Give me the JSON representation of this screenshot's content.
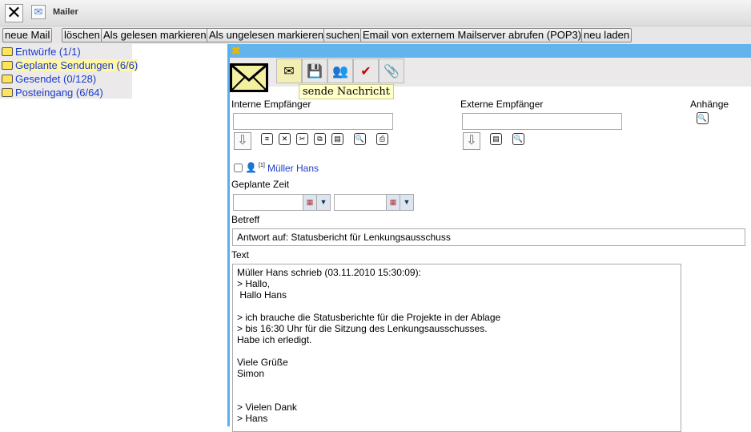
{
  "window": {
    "title": "Mailer"
  },
  "menu": [
    "neue Mail",
    "löschen",
    "Als gelesen markieren",
    "Als ungelesen markieren",
    "suchen",
    "Email von externem Mailserver abrufen (POP3)",
    "neu laden"
  ],
  "folders": [
    {
      "label": "Entwürfe (1/1)"
    },
    {
      "label": "Geplante Sendungen (6/6)",
      "selected": true
    },
    {
      "label": "Gesendet (0/128)"
    },
    {
      "label": "Posteingang (6/64)"
    }
  ],
  "tooltip": "sende Nachricht",
  "form": {
    "internal_label": "Interne Empfänger",
    "external_label": "Externe Empfänger",
    "attachments_label": "Anhänge",
    "recipient": "Müller Hans",
    "recipient_badge": "[1]",
    "planned_label": "Geplante Zeit",
    "subject_label": "Betreff",
    "subject": "Antwort auf: Statusbericht für Lenkungsausschuss",
    "text_label": "Text",
    "text": "Müller Hans schrieb (03.11.2010 15:30:09):\n> Hallo,\n Hallo Hans\n\n> ich brauche die Statusberichte für die Projekte in der Ablage\n> bis 16:30 Uhr für die Sitzung des Lenkungsausschusses.\nHabe ich erledigt.\n\nViele Grüße\nSimon\n\n\n> Vielen Dank\n> Hans"
  }
}
